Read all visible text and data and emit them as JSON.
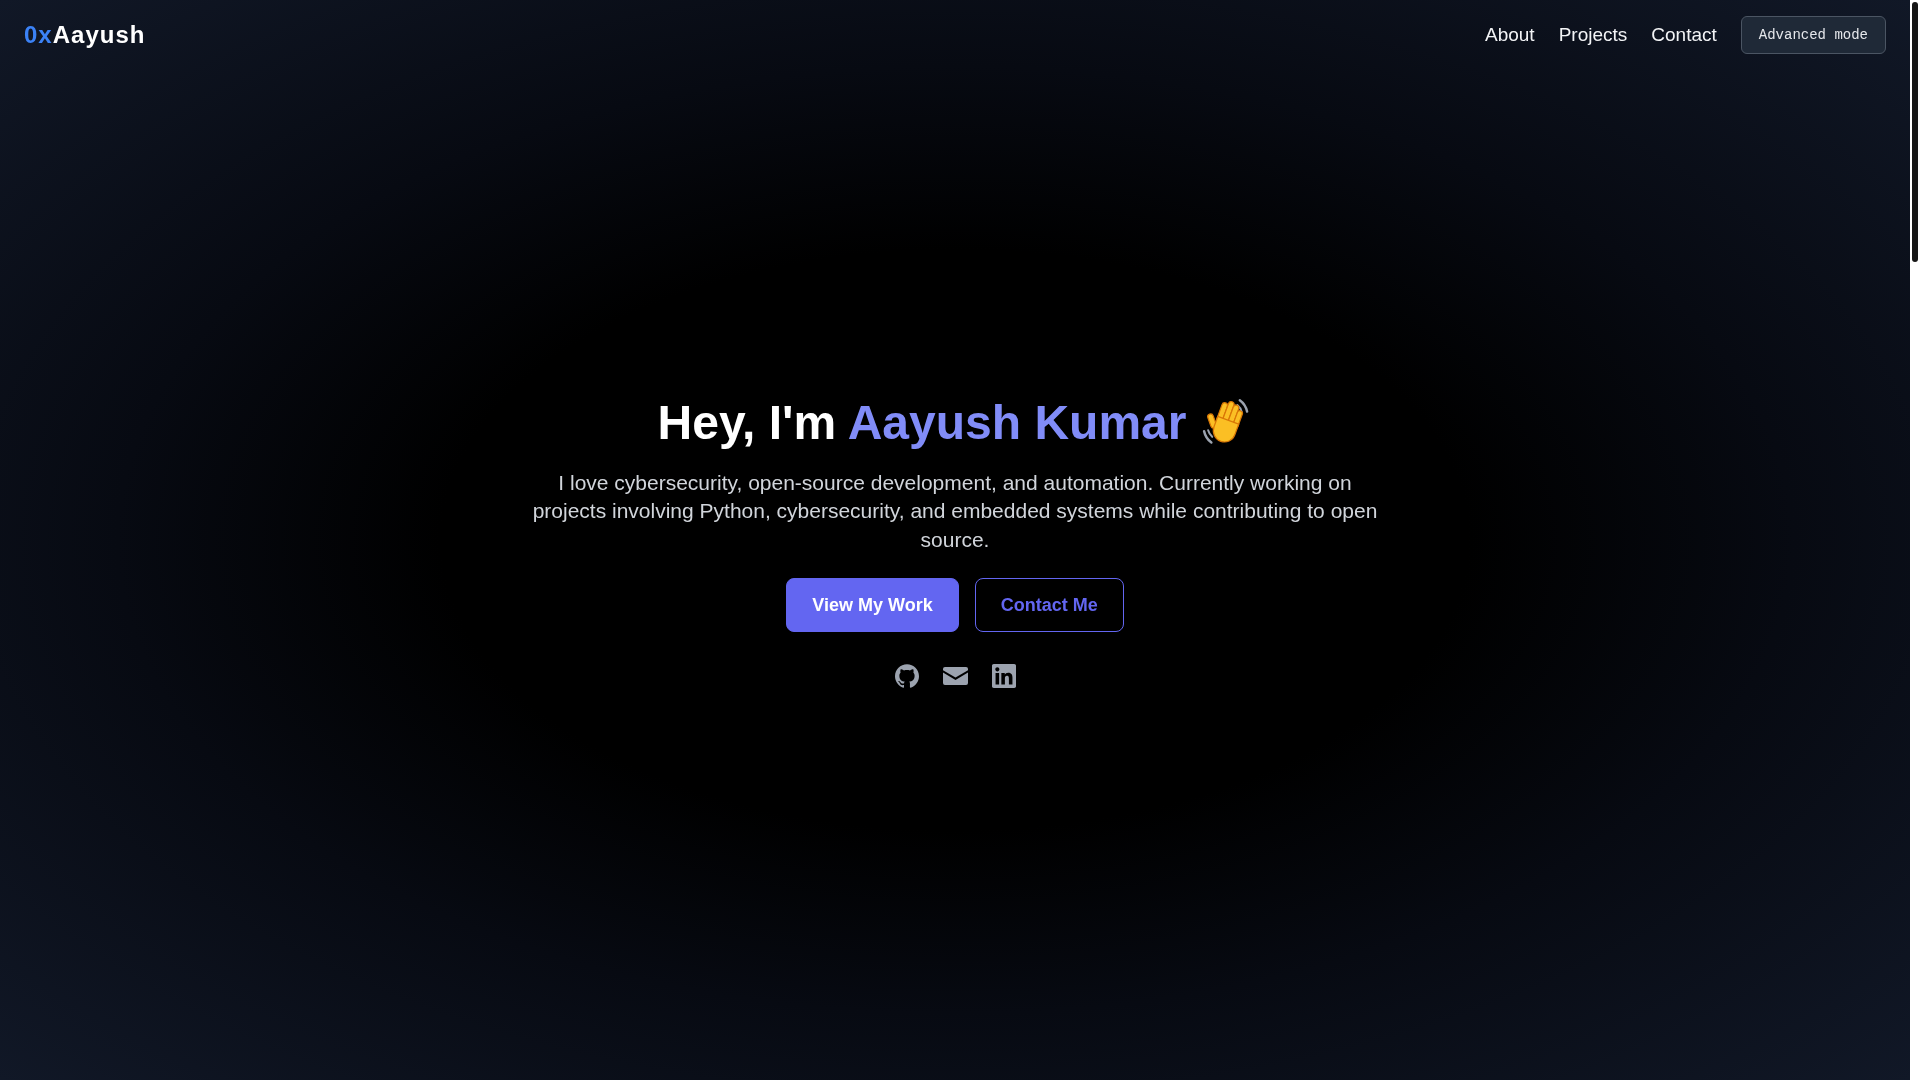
{
  "header": {
    "logo": {
      "prefix": "0x",
      "name": "Aayush"
    },
    "nav_links": [
      "About",
      "Projects",
      "Contact"
    ],
    "mode_button": "Advanced mode"
  },
  "hero": {
    "heading": {
      "text": "Hey, I'm",
      "highlight": "Aayush Kumar"
    },
    "description": "I love cybersecurity, open-source development, and automation. Currently working on projects involving Python, cybersecurity, and embedded systems while contributing to open source.",
    "buttons": [
      {
        "label": "View My Work",
        "kind": "primary"
      },
      {
        "label": "Contact Me",
        "kind": "outline"
      }
    ]
  }
}
